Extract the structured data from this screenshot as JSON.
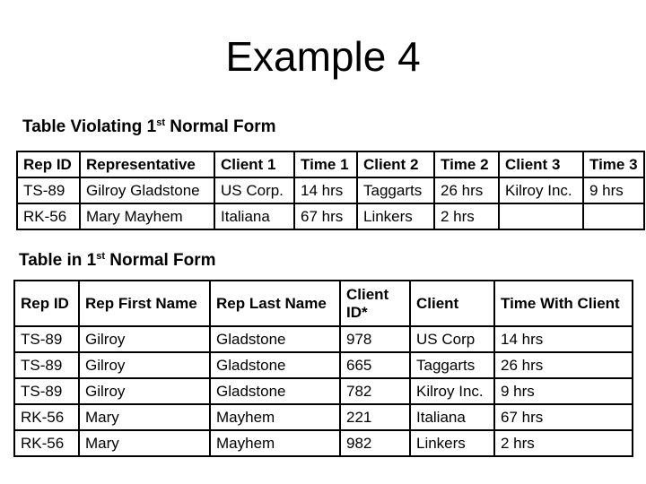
{
  "title": "Example 4",
  "table_violating": {
    "heading": "Table Violating 1",
    "heading_sup": "st",
    "heading_tail": " Normal Form",
    "columns": [
      "Rep ID",
      "Representative",
      "Client 1",
      "Time 1",
      "Client 2",
      "Time 2",
      "Client 3",
      "Time 3"
    ],
    "rows": [
      [
        "TS-89",
        "Gilroy Gladstone",
        "US Corp.",
        "14 hrs",
        "Taggarts",
        "26 hrs",
        "Kilroy Inc.",
        "9 hrs"
      ],
      [
        "RK-56",
        "Mary Mayhem",
        "Italiana",
        "67 hrs",
        "Linkers",
        "2 hrs",
        "",
        ""
      ]
    ]
  },
  "table_normal": {
    "heading": "Table in 1",
    "heading_sup": "st",
    "heading_tail": " Normal Form",
    "columns": [
      "Rep ID",
      "Rep First Name",
      "Rep Last Name",
      "Client ID*",
      "Client",
      "Time With Client"
    ],
    "rows": [
      [
        "TS-89",
        "Gilroy",
        "Gladstone",
        "978",
        "US Corp",
        "14 hrs"
      ],
      [
        "TS-89",
        "Gilroy",
        "Gladstone",
        "665",
        "Taggarts",
        "26 hrs"
      ],
      [
        "TS-89",
        "Gilroy",
        "Gladstone",
        "782",
        "Kilroy Inc.",
        "9 hrs"
      ],
      [
        "RK-56",
        "Mary",
        "Mayhem",
        "221",
        "Italiana",
        "67 hrs"
      ],
      [
        "RK-56",
        "Mary",
        "Mayhem",
        "982",
        "Linkers",
        "2 hrs"
      ]
    ]
  }
}
